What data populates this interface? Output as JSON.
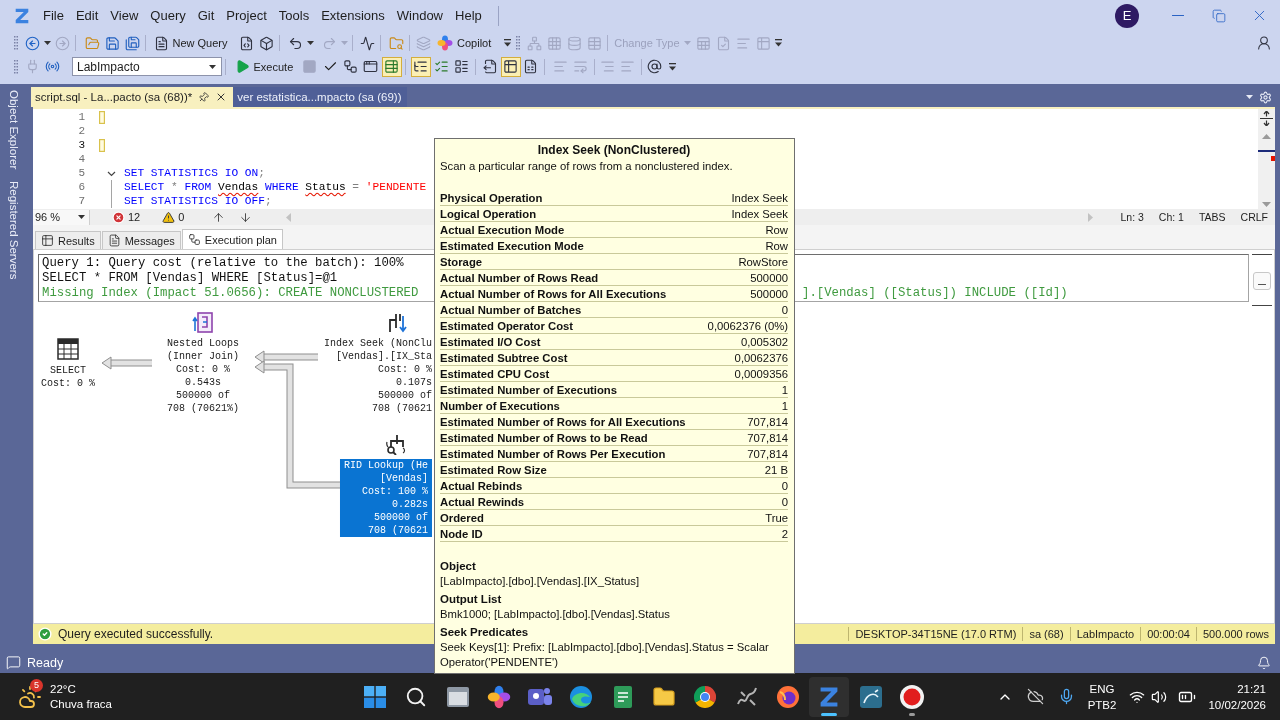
{
  "app": {
    "menu": [
      "File",
      "Edit",
      "View",
      "Query",
      "Git",
      "Project",
      "Tools",
      "Extensions",
      "Window",
      "Help"
    ],
    "account": {
      "initial": "E"
    }
  },
  "standard_toolbar": {
    "buttons": [
      {
        "disabled": false
      },
      {
        "disabled": false
      },
      {
        "disabled": true
      },
      {
        "disabled": false
      },
      {
        "disabled": false
      },
      {
        "disabled": false
      },
      {
        "label": "New Query",
        "disabled": false
      },
      {
        "disabled": false
      },
      {
        "disabled": false
      },
      {
        "disabled": false
      },
      {
        "disabled": false
      },
      {
        "disabled": true
      },
      {
        "disabled": true
      },
      {
        "disabled": false
      },
      {
        "disabled": false
      },
      {
        "disabled": true
      },
      {
        "label": "Copilot",
        "disabled": false
      },
      {
        "disabled": false
      },
      {
        "disabled": true
      },
      {
        "disabled": true
      },
      {
        "disabled": true
      },
      {
        "disabled": true
      },
      {
        "label": "Change Type",
        "disabled": true
      },
      {
        "disabled": true
      },
      {
        "disabled": true
      },
      {
        "disabled": true
      },
      {
        "disabled": true
      },
      {
        "disabled": false
      }
    ]
  },
  "sql_editor_toolbar": {
    "database": "LabImpacto",
    "buttons": [
      {
        "disabled": true,
        "on": false
      },
      {
        "disabled": false,
        "on": false
      },
      {
        "label": "Execute",
        "disabled": false,
        "on": false
      },
      {
        "disabled": true,
        "on": false
      },
      {
        "disabled": false,
        "on": false
      },
      {
        "disabled": false,
        "on": false
      },
      {
        "disabled": false,
        "on": false
      },
      {
        "disabled": false,
        "on": true
      },
      {
        "disabled": false,
        "on": true
      },
      {
        "disabled": false,
        "on": false
      },
      {
        "disabled": false,
        "on": false
      },
      {
        "disabled": false,
        "on": false
      },
      {
        "disabled": false,
        "on": true
      },
      {
        "disabled": false,
        "on": false
      },
      {
        "disabled": true,
        "on": false
      },
      {
        "disabled": true,
        "on": false
      },
      {
        "disabled": true,
        "on": false
      },
      {
        "disabled": true,
        "on": false
      },
      {
        "disabled": false,
        "on": false
      },
      {
        "disabled": false,
        "on": false
      }
    ]
  },
  "side_tabs": [
    "Object Explorer",
    "Registered Servers"
  ],
  "document_tabs": [
    {
      "label": "script.sql - La...pacto (sa (68))*",
      "selected": true
    },
    {
      "label": "ver estatistica...mpacto (sa (69))",
      "selected": false
    }
  ],
  "editor": {
    "lines": [
      {
        "number": "1",
        "current": false,
        "changed": true
      },
      {
        "number": "2",
        "current": false,
        "changed": false
      },
      {
        "number": "3",
        "current": true,
        "changed": true
      },
      {
        "number": "4",
        "current": false,
        "changed": false
      },
      {
        "number": "5",
        "current": false,
        "changed": false,
        "expanded": true,
        "tokens": [
          {
            "kind": "keyword",
            "text": "SET STATISTICS IO ON"
          },
          {
            "kind": "operator",
            "text": ";"
          }
        ]
      },
      {
        "number": "6",
        "current": false,
        "changed": false,
        "tokens": [
          {
            "kind": "keyword",
            "text": "SELECT "
          },
          {
            "kind": "operator",
            "text": "* "
          },
          {
            "kind": "keyword",
            "text": "FROM "
          },
          {
            "kind": "unresolved",
            "text": "Vendas"
          },
          {
            "kind": "keyword",
            "text": " WHERE "
          },
          {
            "kind": "unresolved",
            "text": "Status"
          },
          {
            "kind": "operator",
            "text": " = "
          },
          {
            "kind": "string",
            "text": "'PENDENTE"
          }
        ]
      },
      {
        "number": "7",
        "current": false,
        "changed": false,
        "tokens": [
          {
            "kind": "keyword",
            "text": "SET STATISTICS IO OFF"
          },
          {
            "kind": "operator",
            "text": ";"
          }
        ]
      }
    ]
  },
  "editor_status": {
    "zoom": "96 %",
    "errors": "12",
    "warnings": "0",
    "position": [
      "Ln: 3",
      "Ch: 1",
      "TABS",
      "CRLF"
    ]
  },
  "result_tabs": [
    {
      "label": "Results",
      "selected": false
    },
    {
      "label": "Messages",
      "selected": false
    },
    {
      "label": "Execution plan",
      "selected": true
    }
  ],
  "query_header": {
    "lines": [
      "Query 1: Query cost (relative to the batch): 100%",
      "SELECT * FROM [Vendas] WHERE [Status]=@1"
    ],
    "missing_index": [
      "Missing Index (Impact 51.0656): CREATE NONCLUSTERED",
      "].[Vendas] ([Status]) INCLUDE ([Id])"
    ]
  },
  "plan": {
    "root": {
      "kind": "select",
      "caption": [
        "SELECT",
        "Cost: 0 %"
      ],
      "selected": false,
      "children": [
        {
          "kind": "nested-loops",
          "caption": [
            "Nested Loops",
            "(Inner Join)",
            "Cost: 0 %",
            "0.543s",
            "500000 of",
            "708 (70621%)"
          ],
          "selected": false,
          "children": [
            {
              "kind": "index-seek",
              "caption": [
                "Index Seek (NonClu",
                "[Vendas].[IX_Sta",
                "Cost: 0 %",
                "0.107s",
                "500000 of",
                "708 (70621"
              ],
              "selected": false
            },
            {
              "kind": "rid-lookup",
              "caption": [
                "RID Lookup (He",
                "[Vendas]",
                "Cost: 100 %",
                "0.282s",
                "500000 of",
                "708 (70621"
              ],
              "selected": true
            }
          ]
        }
      ]
    }
  },
  "execution_status": {
    "message": "Query executed successfully.",
    "fields": [
      "DESKTOP-34T15NE (17.0 RTM)",
      "sa (68)",
      "LabImpacto",
      "00:00:04",
      "500.000 rows"
    ]
  },
  "status_bar": {
    "text": "Ready"
  },
  "tooltip": {
    "title": "Index Seek (NonClustered)",
    "description": "Scan a particular range of rows from a nonclustered index.",
    "properties": [
      {
        "name": "Physical Operation",
        "value": "Index Seek"
      },
      {
        "name": "Logical Operation",
        "value": "Index Seek"
      },
      {
        "name": "Actual Execution Mode",
        "value": "Row"
      },
      {
        "name": "Estimated Execution Mode",
        "value": "Row"
      },
      {
        "name": "Storage",
        "value": "RowStore"
      },
      {
        "name": "Actual Number of Rows Read",
        "value": "500000"
      },
      {
        "name": "Actual Number of Rows for All Executions",
        "value": "500000"
      },
      {
        "name": "Actual Number of Batches",
        "value": "0"
      },
      {
        "name": "Estimated Operator Cost",
        "value": "0,0062376 (0%)"
      },
      {
        "name": "Estimated I/O Cost",
        "value": "0,005302"
      },
      {
        "name": "Estimated Subtree Cost",
        "value": "0,0062376"
      },
      {
        "name": "Estimated CPU Cost",
        "value": "0,0009356"
      },
      {
        "name": "Estimated Number of Executions",
        "value": "1"
      },
      {
        "name": "Number of Executions",
        "value": "1"
      },
      {
        "name": "Estimated Number of Rows for All Executions",
        "value": "707,814"
      },
      {
        "name": "Estimated Number of Rows to be Read",
        "value": "707,814"
      },
      {
        "name": "Estimated Number of Rows Per Execution",
        "value": "707,814"
      },
      {
        "name": "Estimated Row Size",
        "value": "21 B"
      },
      {
        "name": "Actual Rebinds",
        "value": "0"
      },
      {
        "name": "Actual Rewinds",
        "value": "0"
      },
      {
        "name": "Ordered",
        "value": "True"
      },
      {
        "name": "Node ID",
        "value": "2"
      }
    ],
    "sections": [
      {
        "heading": "Object",
        "text": "[LabImpacto].[dbo].[Vendas].[IX_Status]"
      },
      {
        "heading": "Output List",
        "text": "Bmk1000; [LabImpacto].[dbo].[Vendas].Status"
      },
      {
        "heading": "Seek Predicates",
        "text": "Seek Keys[1]: Prefix: [LabImpacto].[dbo].[Vendas].Status = Scalar Operator('PENDENTE')"
      }
    ]
  },
  "taskbar": {
    "weather": {
      "badge": "5",
      "temperature": "22°C",
      "condition": "Chuva fraca"
    },
    "apps": [
      {
        "running": false,
        "selected": false
      },
      {
        "running": false,
        "selected": false
      },
      {
        "running": false,
        "selected": false
      },
      {
        "running": false,
        "selected": false
      },
      {
        "running": false,
        "selected": false
      },
      {
        "running": false,
        "selected": false
      },
      {
        "running": false,
        "selected": false
      },
      {
        "running": false,
        "selected": false
      },
      {
        "running": false,
        "selected": false
      },
      {
        "running": false,
        "selected": false
      },
      {
        "running": false,
        "selected": false
      },
      {
        "running": true,
        "selected": true
      },
      {
        "running": false,
        "selected": false
      },
      {
        "running": true,
        "selected": false
      }
    ],
    "language": [
      "ENG",
      "PTB2"
    ],
    "time": "21:21",
    "date": "10/02/2026"
  }
}
